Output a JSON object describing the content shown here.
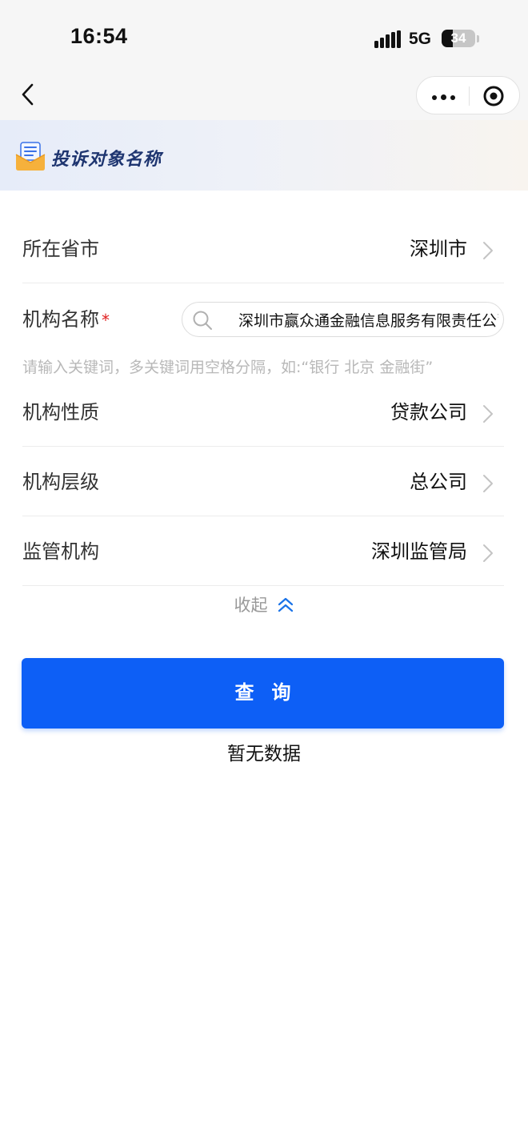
{
  "status_bar": {
    "time": "16:54",
    "network": "5G",
    "battery": "34"
  },
  "nav": {
    "back_icon": "chevron-left-icon",
    "more_icon": "more-dots-icon",
    "close_icon": "target-circle-icon"
  },
  "header": {
    "title": "投诉对象名称",
    "icon": "envelope-document-icon"
  },
  "form": {
    "province_city": {
      "label": "所在省市",
      "value": "深圳市"
    },
    "institution_name": {
      "label": "机构名称",
      "required_mark": "*",
      "value": "深圳市赢众通金融信息服务有限责任公司",
      "hint": "请输入关键词，多关键词用空格分隔，如:“银行 北京 金融街”"
    },
    "nature": {
      "label": "机构性质",
      "value": "贷款公司"
    },
    "level": {
      "label": "机构层级",
      "value": "总公司"
    },
    "regulator": {
      "label": "监管机构",
      "value": "深圳监管局"
    },
    "collapse_label": "收起"
  },
  "query_button": {
    "label": "查询"
  },
  "result": {
    "empty_text": "暂无数据"
  },
  "colors": {
    "primary": "#0d5ff6",
    "required": "#e02020",
    "hint": "#b8b8b8",
    "title": "#1e3570"
  }
}
